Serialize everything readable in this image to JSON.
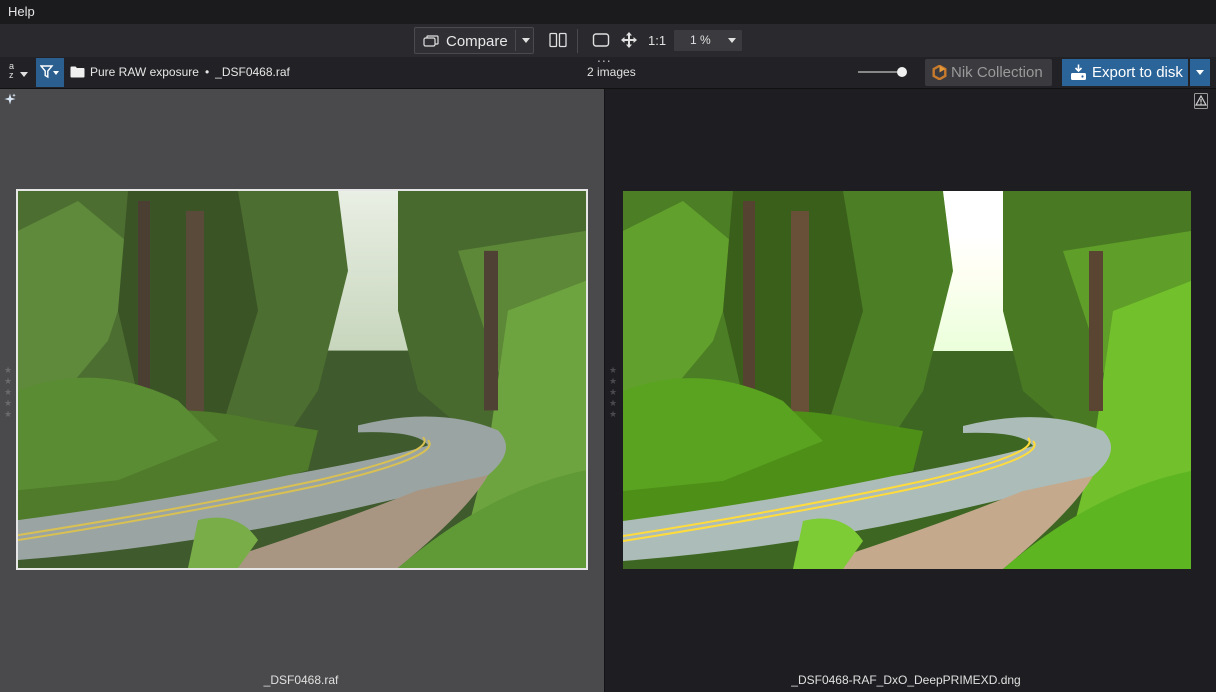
{
  "menu": {
    "help": "Help"
  },
  "toolbar": {
    "compare_label": "Compare",
    "one_to_one": "1:1",
    "zoom_value": "1 %"
  },
  "pathbar": {
    "folder": "Pure RAW exposure",
    "separator": "•",
    "file": "_DSF0468.raf",
    "handle": "...",
    "count": "2 images",
    "thumbnail_size_level": 0.9,
    "nik_label": "Nik Collection",
    "export_label": "Export to disk"
  },
  "panes": {
    "left": {
      "caption": "_DSF0468.raf"
    },
    "right": {
      "caption": "_DSF0468-RAF_DxO_DeepPRIMEXD.dng"
    }
  },
  "icons": {
    "compare": "compare-icon",
    "split": "split-view-icon",
    "fit": "fit-screen-icon",
    "move": "move-icon",
    "filter": "filter-icon",
    "folder": "folder-icon",
    "nik": "nik-logo-icon",
    "export": "export-icon",
    "sparkle": "sparkle-icon",
    "warning": "warning-icon",
    "star": "star-icon"
  },
  "colors": {
    "accent": "#2a6498",
    "filter_active": "#2a5f8f",
    "left_pane_bg": "#4a4a4c",
    "right_pane_bg": "#1e1e22"
  }
}
